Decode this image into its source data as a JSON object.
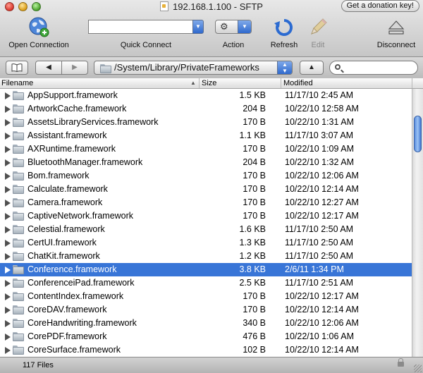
{
  "window": {
    "title": "192.168.1.100 - SFTP",
    "donate_label": "Get a donation key!"
  },
  "toolbar": {
    "open_connection": "Open Connection",
    "quick_connect": "Quick Connect",
    "quick_connect_value": "",
    "action": "Action",
    "refresh": "Refresh",
    "edit": "Edit",
    "disconnect": "Disconnect"
  },
  "pathbar": {
    "path": "/System/Library/PrivateFrameworks",
    "search_value": ""
  },
  "columns": {
    "filename": "Filename",
    "size": "Size",
    "modified": "Modified"
  },
  "files": [
    {
      "name": "AppSupport.framework",
      "size": "1.5 KB",
      "modified": "11/17/10 2:45 AM"
    },
    {
      "name": "ArtworkCache.framework",
      "size": "204 B",
      "modified": "10/22/10 12:58 AM"
    },
    {
      "name": "AssetsLibraryServices.framework",
      "size": "170 B",
      "modified": "10/22/10 1:31 AM"
    },
    {
      "name": "Assistant.framework",
      "size": "1.1 KB",
      "modified": "11/17/10 3:07 AM"
    },
    {
      "name": "AXRuntime.framework",
      "size": "170 B",
      "modified": "10/22/10 1:09 AM"
    },
    {
      "name": "BluetoothManager.framework",
      "size": "204 B",
      "modified": "10/22/10 1:32 AM"
    },
    {
      "name": "Bom.framework",
      "size": "170 B",
      "modified": "10/22/10 12:06 AM"
    },
    {
      "name": "Calculate.framework",
      "size": "170 B",
      "modified": "10/22/10 12:14 AM"
    },
    {
      "name": "Camera.framework",
      "size": "170 B",
      "modified": "10/22/10 12:27 AM"
    },
    {
      "name": "CaptiveNetwork.framework",
      "size": "170 B",
      "modified": "10/22/10 12:17 AM"
    },
    {
      "name": "Celestial.framework",
      "size": "1.6 KB",
      "modified": "11/17/10 2:50 AM"
    },
    {
      "name": "CertUI.framework",
      "size": "1.3 KB",
      "modified": "11/17/10 2:50 AM"
    },
    {
      "name": "ChatKit.framework",
      "size": "1.2 KB",
      "modified": "11/17/10 2:50 AM"
    },
    {
      "name": "Conference.framework",
      "size": "3.8 KB",
      "modified": "2/6/11 1:34 PM",
      "selected": true
    },
    {
      "name": "ConferenceiPad.framework",
      "size": "2.5 KB",
      "modified": "11/17/10 2:51 AM"
    },
    {
      "name": "ContentIndex.framework",
      "size": "170 B",
      "modified": "10/22/10 12:17 AM"
    },
    {
      "name": "CoreDAV.framework",
      "size": "170 B",
      "modified": "10/22/10 12:14 AM"
    },
    {
      "name": "CoreHandwriting.framework",
      "size": "340 B",
      "modified": "10/22/10 12:06 AM"
    },
    {
      "name": "CorePDF.framework",
      "size": "476 B",
      "modified": "10/22/10 1:06 AM"
    },
    {
      "name": "CoreSurface.framework",
      "size": "102 B",
      "modified": "10/22/10 12:14 AM"
    }
  ],
  "status": {
    "count_text": "117 Files"
  },
  "colors": {
    "selection": "#3875d7",
    "accent_blue": "#2f69cd"
  }
}
